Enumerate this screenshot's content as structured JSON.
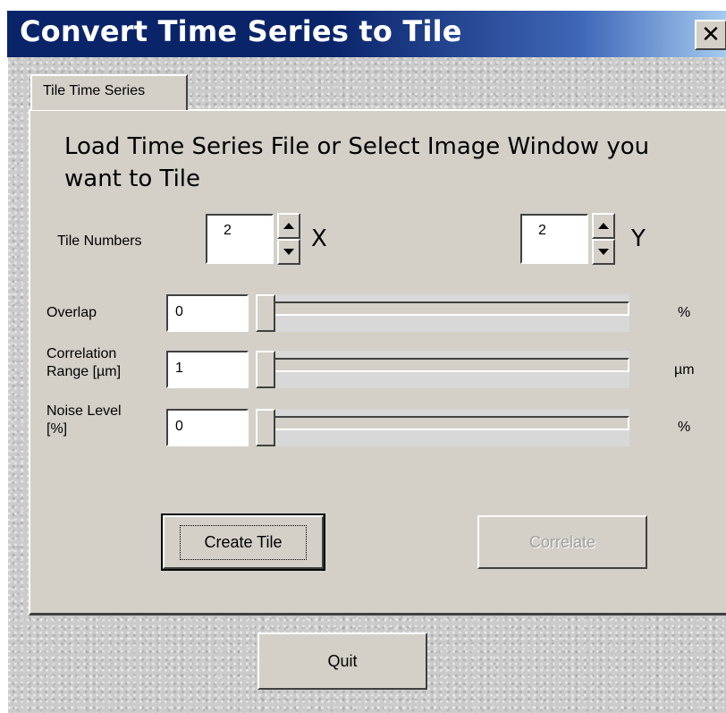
{
  "window": {
    "title": "Convert Time Series to Tile",
    "close_label": "✕"
  },
  "tabs": [
    {
      "label": "Tile Time Series",
      "selected": true
    }
  ],
  "main": {
    "heading": "Load Time Series File or Select Image Window you want to Tile",
    "tile_numbers": {
      "label": "Tile Numbers",
      "x_value": "2",
      "x_axis": "X",
      "y_value": "2",
      "y_axis": "Y"
    },
    "overlap": {
      "label": "Overlap",
      "value": "0",
      "unit": "%",
      "slider_value": 0
    },
    "correlation_range": {
      "label": "Correlation Range [µm]",
      "value": "1",
      "unit": "µm",
      "slider_value": 0
    },
    "noise_level": {
      "label": "Noise Level [%]",
      "value": "0",
      "unit": "%",
      "slider_value": 0
    },
    "create_tile_label": "Create Tile",
    "correlate_label": "Correlate",
    "correlate_enabled": false
  },
  "footer": {
    "quit_label": "Quit"
  },
  "colors": {
    "titlebar_start": "#0a246a",
    "titlebar_end": "#a6caf0",
    "face": "#d4d0c8"
  }
}
